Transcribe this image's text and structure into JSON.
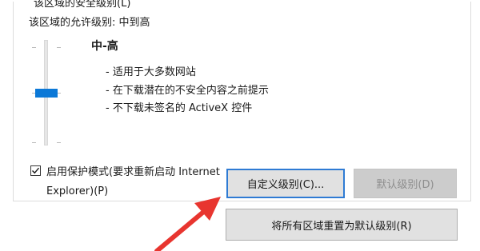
{
  "group": {
    "legend": "该区域的安全级别(L)",
    "allowed_level": "该区域的允许级别: 中到高"
  },
  "slider": {
    "level_fraction": 0.5
  },
  "level": {
    "name": "中-高",
    "descriptions": [
      "- 适用于大多数网站",
      "- 在下载潜在的不安全内容之前提示",
      "- 不下载未签名的 ActiveX 控件"
    ]
  },
  "protected_mode": {
    "checked": true,
    "label": "启用保护模式(要求重新启动 Internet Explorer)(P)"
  },
  "buttons": {
    "custom_level": "自定义级别(C)...",
    "default_level": "默认级别(D)",
    "reset_all": "将所有区域重置为默认级别(R)"
  },
  "colors": {
    "accent": "#0b78d7",
    "annotation_arrow": "#e8352f"
  }
}
